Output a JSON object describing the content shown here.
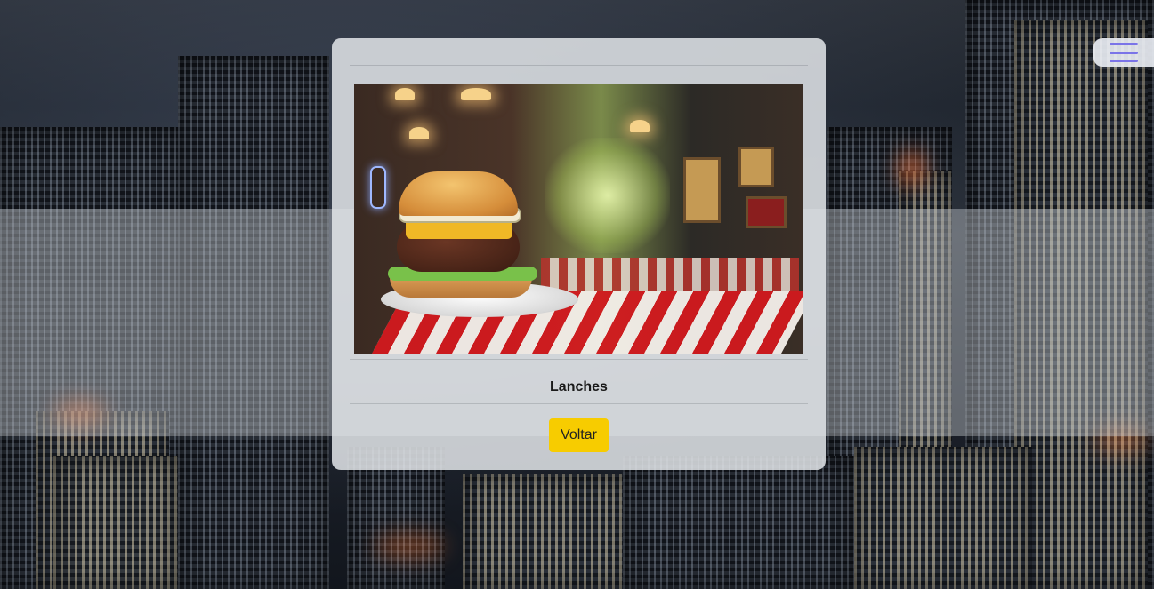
{
  "menu": {
    "icon": "hamburger-menu-icon"
  },
  "card": {
    "image_subject": "burger-photo",
    "title": "Lanches",
    "back_label": "Voltar"
  },
  "colors": {
    "menu_icon": "#7b74e8",
    "button_bg": "#f7cc00"
  }
}
